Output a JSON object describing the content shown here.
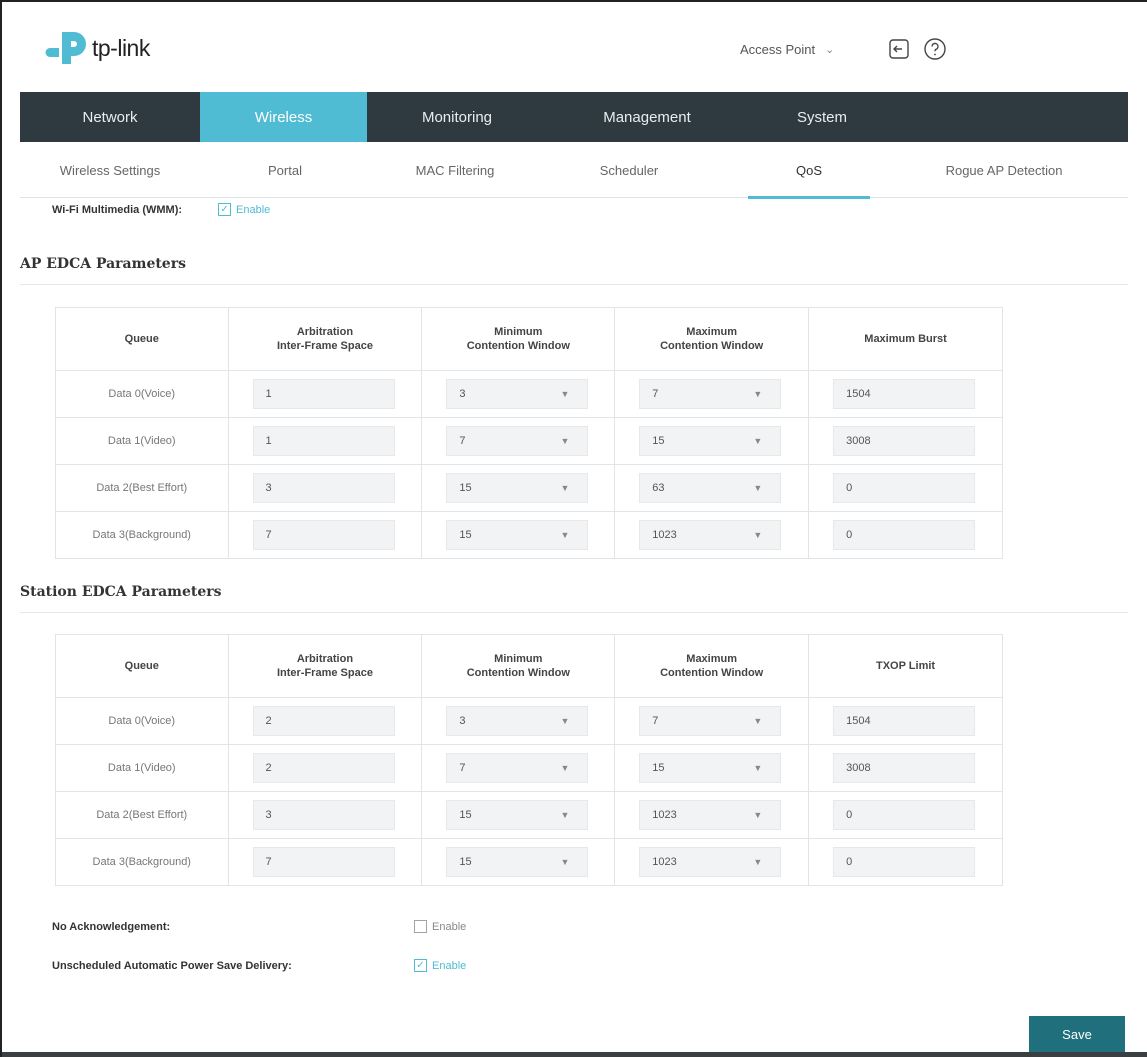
{
  "header": {
    "logo_text": "tp-link",
    "mode_select": "Access Point",
    "mode_caret": "⌄"
  },
  "main_nav": [
    {
      "label": "Network",
      "active": false
    },
    {
      "label": "Wireless",
      "active": true
    },
    {
      "label": "Monitoring",
      "active": false
    },
    {
      "label": "Management",
      "active": false
    },
    {
      "label": "System",
      "active": false
    }
  ],
  "sub_nav": [
    {
      "label": "Wireless Settings",
      "active": false
    },
    {
      "label": "Portal",
      "active": false
    },
    {
      "label": "MAC Filtering",
      "active": false
    },
    {
      "label": "Scheduler",
      "active": false
    },
    {
      "label": "QoS",
      "active": true
    },
    {
      "label": "Rogue AP Detection",
      "active": false
    }
  ],
  "wmm": {
    "label": "Wi-Fi Multimedia (WMM):",
    "checked": true,
    "enable_label": "Enable"
  },
  "ap_section": {
    "title": "AP EDCA Parameters",
    "headers": {
      "queue": "Queue",
      "aifs_l1": "Arbitration",
      "aifs_l2": "Inter-Frame Space",
      "min_l1": "Minimum",
      "min_l2": "Contention Window",
      "max_l1": "Maximum",
      "max_l2": "Contention Window",
      "last": "Maximum Burst"
    },
    "rows": [
      {
        "queue": "Data 0(Voice)",
        "aifs": "1",
        "min": "3",
        "max": "7",
        "last": "1504"
      },
      {
        "queue": "Data 1(Video)",
        "aifs": "1",
        "min": "7",
        "max": "15",
        "last": "3008"
      },
      {
        "queue": "Data 2(Best Effort)",
        "aifs": "3",
        "min": "15",
        "max": "63",
        "last": "0"
      },
      {
        "queue": "Data 3(Background)",
        "aifs": "7",
        "min": "15",
        "max": "1023",
        "last": "0"
      }
    ]
  },
  "station_section": {
    "title": "Station EDCA Parameters",
    "headers": {
      "queue": "Queue",
      "aifs_l1": "Arbitration",
      "aifs_l2": "Inter-Frame Space",
      "min_l1": "Minimum",
      "min_l2": "Contention Window",
      "max_l1": "Maximum",
      "max_l2": "Contention Window",
      "last": "TXOP Limit"
    },
    "rows": [
      {
        "queue": "Data 0(Voice)",
        "aifs": "2",
        "min": "3",
        "max": "7",
        "last": "1504"
      },
      {
        "queue": "Data 1(Video)",
        "aifs": "2",
        "min": "7",
        "max": "15",
        "last": "3008"
      },
      {
        "queue": "Data 2(Best Effort)",
        "aifs": "3",
        "min": "15",
        "max": "1023",
        "last": "0"
      },
      {
        "queue": "Data 3(Background)",
        "aifs": "7",
        "min": "15",
        "max": "1023",
        "last": "0"
      }
    ]
  },
  "no_ack": {
    "label": "No Acknowledgement:",
    "checked": false,
    "enable_label": "Enable"
  },
  "apsd": {
    "label": "Unscheduled Automatic Power Save Delivery:",
    "checked": true,
    "enable_label": "Enable"
  },
  "save_label": "Save",
  "icons": {
    "check": "✓",
    "caret": "▼"
  },
  "colors": {
    "nav_bg": "#2f3a40",
    "accent": "#4fbcd3",
    "save_bg": "#1f6f7c"
  }
}
